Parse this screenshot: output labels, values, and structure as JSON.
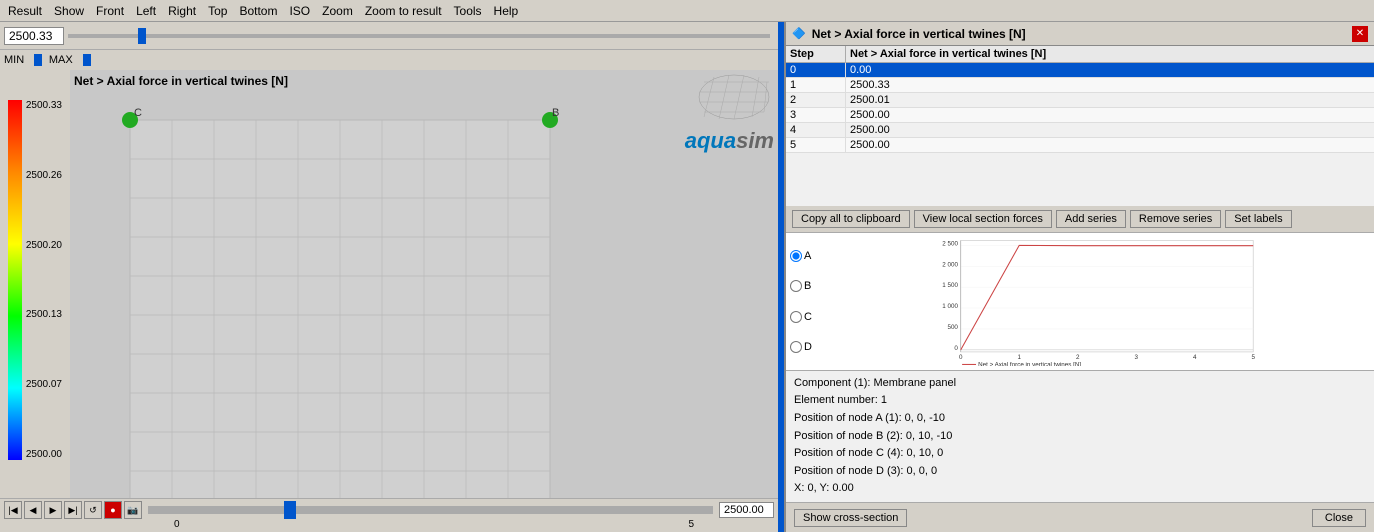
{
  "menubar": {
    "items": [
      "Result",
      "Show",
      "Front",
      "Left",
      "Right",
      "Top",
      "Bottom",
      "ISO",
      "Zoom",
      "Zoom to result",
      "Tools",
      "Help"
    ]
  },
  "left_panel": {
    "slider_value": "2500.33",
    "min_label": "MIN",
    "max_label": "MAX",
    "scene_title": "Net > Axial force in vertical twines [N]",
    "colorbar": {
      "values": [
        "2500.33",
        "2500.26",
        "2500.20",
        "2500.13",
        "2500.07",
        "2500.00"
      ]
    },
    "timeline": {
      "value": "2500.00",
      "start_label": "0",
      "end_label": "5"
    }
  },
  "right_panel": {
    "title": "Net > Axial force in vertical twines [N]",
    "window_title": "Net > Axial force in vertical twines [N]",
    "table": {
      "col_step": "Step",
      "col_value": "Net > Axial force in vertical twines [N]",
      "rows": [
        {
          "step": "0",
          "value": "0.00",
          "selected": true
        },
        {
          "step": "1",
          "value": "2500.33"
        },
        {
          "step": "2",
          "value": "2500.01"
        },
        {
          "step": "3",
          "value": "2500.00"
        },
        {
          "step": "4",
          "value": "2500.00"
        },
        {
          "step": "5",
          "value": "2500.00"
        }
      ]
    },
    "buttons": {
      "copy": "Copy all to clipboard",
      "view_local": "View local section forces",
      "add_series": "Add series",
      "remove_series": "Remove series",
      "set_labels": "Set labels"
    },
    "chart": {
      "y_max": "2 500",
      "y_2000": "2 000",
      "y_1500": "1 500",
      "y_1000": "1 000",
      "y_500": "500",
      "y_0": "0",
      "x_labels": [
        "0",
        "1",
        "2",
        "3",
        "4",
        "5"
      ],
      "legend": "Net > Axial force in vertical twines [N]",
      "radio_options": [
        "A",
        "B",
        "C",
        "D"
      ]
    },
    "info": {
      "component": "Component (1): Membrane panel",
      "element": "Element number: 1",
      "node_a": "Position of node A (1): 0, 0, -10",
      "node_b": "Position of node B (2): 0, 10, -10",
      "node_c": "Position of node C (4): 0, 10, 0",
      "node_d": "Position of node D (3): 0, 0, 0",
      "xy": "X: 0, Y: 0.00"
    },
    "bottom": {
      "show_cross": "Show cross-section",
      "close": "Close"
    }
  }
}
